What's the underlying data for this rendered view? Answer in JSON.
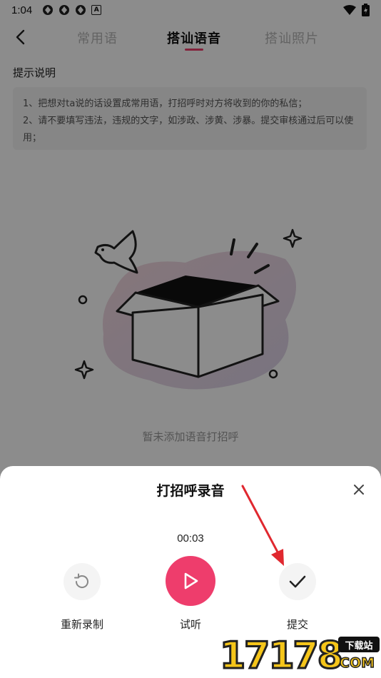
{
  "status_bar": {
    "time": "1:04",
    "notif_letter": "A"
  },
  "tabs": [
    {
      "label": "常用语",
      "active": false
    },
    {
      "label": "搭讪语音",
      "active": true
    },
    {
      "label": "搭讪照片",
      "active": false
    }
  ],
  "hint": {
    "title": "提示说明",
    "lines": [
      "1、把想对ta说的话设置成常用语，打招呼时对方将收到的你的私信；",
      "2、请不要填写违法，违规的文字，如涉政、涉黄、涉暴。提交审核通过后可以使用；"
    ]
  },
  "empty_state": {
    "text": "暂未添加语音打招呼"
  },
  "sheet": {
    "title": "打招呼录音",
    "timer": "00:03",
    "rerecord_label": "重新录制",
    "play_label": "试听",
    "submit_label": "提交"
  },
  "watermark": {
    "digits": "17178",
    "badge": "下载站",
    "suffix": "COM"
  },
  "colors": {
    "accent": "#ee3d6c",
    "arrow": "#e0282f",
    "overlay": "rgba(0,0,0,0.45)"
  },
  "icons": {
    "back": "chevron-left-icon",
    "close": "close-icon",
    "rerecord": "refresh-icon",
    "play": "play-icon",
    "submit": "check-icon"
  }
}
